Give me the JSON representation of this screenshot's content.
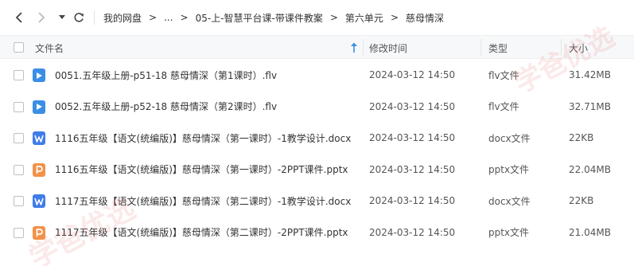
{
  "nav": {
    "back_icon": "chevron-left-icon",
    "forward_icon": "chevron-right-icon",
    "dropdown_icon": "caret-down-icon",
    "refresh_icon": "refresh-icon"
  },
  "breadcrumb": {
    "root": "我的网盘",
    "ellipsis": "...",
    "items": [
      "05-上-智慧平台课-带课件教案",
      "第六单元",
      "慈母情深"
    ],
    "separator": ">"
  },
  "table": {
    "columns": {
      "name": "文件名",
      "modified": "修改时间",
      "type": "类型",
      "size": "大小"
    },
    "sort_icon": "sort-up-arrow-icon",
    "rows": [
      {
        "icon": "video-file-icon",
        "icon_color": "#3a8ee6",
        "name": "0051.五年级上册-p51-18 慈母情深（第1课时）.flv",
        "date": "2024-03-12 14:50",
        "type": "flv文件",
        "size": "31.42MB"
      },
      {
        "icon": "video-file-icon",
        "icon_color": "#3a8ee6",
        "name": "0052.五年级上册-p52-18 慈母情深（第2课时）.flv",
        "date": "2024-03-12 14:50",
        "type": "flv文件",
        "size": "32.71MB"
      },
      {
        "icon": "word-file-icon",
        "icon_color": "#3f7de8",
        "name": "1116五年级【语文(统编版)】慈母情深（第一课时）-1教学设计.docx",
        "date": "2024-03-12 14:50",
        "type": "docx文件",
        "size": "22KB"
      },
      {
        "icon": "ppt-file-icon",
        "icon_color": "#f2924a",
        "name": "1116五年级【语文(统编版)】慈母情深（第一课时）-2PPT课件.pptx",
        "date": "2024-03-12 14:50",
        "type": "pptx文件",
        "size": "22.04MB"
      },
      {
        "icon": "word-file-icon",
        "icon_color": "#3f7de8",
        "name": "1117五年级【语文(统编版)】慈母情深（第二课时）-1教学设计.docx",
        "date": "2024-03-12 14:50",
        "type": "docx文件",
        "size": "22KB"
      },
      {
        "icon": "ppt-file-icon",
        "icon_color": "#f2924a",
        "name": "1117五年级【语文(统编版)】慈母情深（第二课时）-2PPT课件.pptx",
        "date": "2024-03-12 14:50",
        "type": "pptx文件",
        "size": "21.04MB"
      }
    ]
  },
  "watermark": {
    "text_a": "学爸优选",
    "text_b": "学爸优选"
  }
}
